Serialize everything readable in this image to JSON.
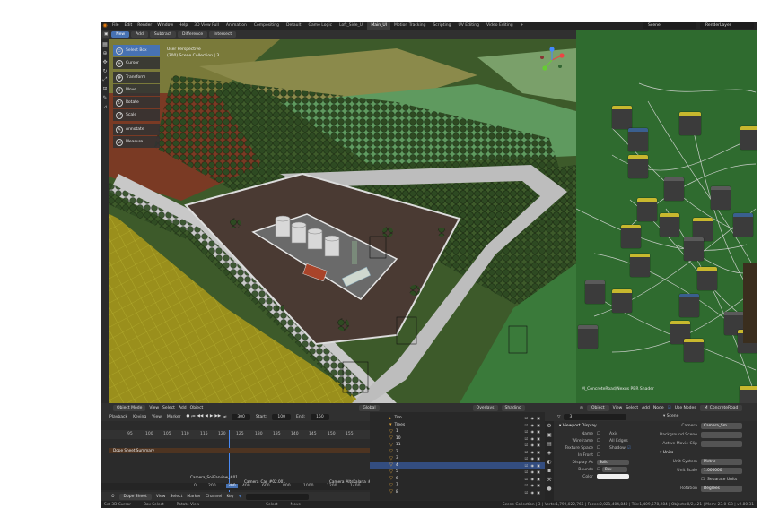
{
  "topbar": {
    "menus": [
      "File",
      "Edit",
      "Render",
      "Window",
      "Help"
    ],
    "workspaces": [
      "3D View Full",
      "Animation",
      "Compositing",
      "Default",
      "Game Logic",
      "Loft_Side_UI",
      "Main_UI",
      "Motion Tracking",
      "Scripting",
      "UV Editing",
      "Video Editing"
    ],
    "active_workspace": "Main_UI",
    "scene": "Scene",
    "render_layer": "RenderLayer"
  },
  "mode_buttons": [
    "New",
    "Add",
    "Subtract",
    "Difference",
    "Intersect"
  ],
  "tools": [
    {
      "label": "Select Box",
      "icon": "select-box-icon",
      "active": true
    },
    {
      "label": "Cursor",
      "icon": "cursor-icon",
      "active": false
    },
    {
      "label": "Transform",
      "icon": "transform-icon",
      "active": false
    },
    {
      "label": "Move",
      "icon": "move-icon",
      "active": false
    },
    {
      "label": "Rotate",
      "icon": "rotate-icon",
      "active": false
    },
    {
      "label": "Scale",
      "icon": "scale-icon",
      "active": false
    },
    {
      "label": "Annotate",
      "icon": "annotate-icon",
      "active": false
    },
    {
      "label": "Measure",
      "icon": "measure-icon",
      "active": false
    }
  ],
  "viewport": {
    "view_name": "User Perspective",
    "collection": "(300) Scene Collection | 3",
    "mode": "Object Mode",
    "menus": [
      "View",
      "Select",
      "Add",
      "Object"
    ],
    "orientation": "Global",
    "overlays": "Overlays",
    "shading": "Shading"
  },
  "node_editor": {
    "material_label": "M_ConcreteRoad/Nexus PBR Shader",
    "object_menu": "Object",
    "menus": [
      "View",
      "Select",
      "Add",
      "Node"
    ],
    "use_nodes": "Use Nodes",
    "material": "M_ConcreteRoad"
  },
  "dope_sheet": {
    "playback": "Playback",
    "keying": "Keying",
    "menus": [
      "View",
      "Marker"
    ],
    "current_frame": "300",
    "start_label": "Start:",
    "start": "100",
    "end_label": "End:",
    "end": "150",
    "ruler_ticks": [
      "95",
      "100",
      "105",
      "110",
      "115",
      "120",
      "125",
      "130",
      "135",
      "140",
      "145",
      "150",
      "155"
    ],
    "summary": "Dope Sheet Summary",
    "markers": [
      "Camera_SoilFarview_#01",
      "Camera_Car_#02.001",
      "Camera_AltsKalaria_#"
    ],
    "bottom_ticks": [
      "0",
      "200",
      "300",
      "400",
      "600",
      "800",
      "1000",
      "1200",
      "1400"
    ],
    "footer_mode": "Dope Sheet",
    "footer_menus": [
      "View",
      "Select",
      "Marker",
      "Channel",
      "Key"
    ]
  },
  "outliner": {
    "rows": [
      {
        "label": "Trm",
        "selected": false
      },
      {
        "label": "Trees",
        "selected": false
      },
      {
        "label": "1",
        "selected": false
      },
      {
        "label": "10",
        "selected": false
      },
      {
        "label": "11",
        "selected": false
      },
      {
        "label": "2",
        "selected": false
      },
      {
        "label": "3",
        "selected": false
      },
      {
        "label": "4",
        "selected": false
      },
      {
        "label": "5",
        "selected": false
      },
      {
        "label": "6",
        "selected": false
      },
      {
        "label": "7",
        "selected": false
      },
      {
        "label": "8",
        "selected": false
      }
    ]
  },
  "properties": {
    "object_name": "3",
    "section": "Viewport Display",
    "fields": [
      {
        "label": "Name",
        "value": "",
        "right_label": "Axis"
      },
      {
        "label": "Wireframe",
        "value": "",
        "right_label": "All Edges"
      },
      {
        "label": "Texture Space",
        "value": "",
        "right_label": "Shadow"
      },
      {
        "label": "In Front",
        "value": ""
      },
      {
        "label": "Display As",
        "value": "Solid"
      },
      {
        "label": "Bounds",
        "value": "Box"
      },
      {
        "label": "Color",
        "value": ""
      }
    ]
  },
  "scene_props": {
    "header": "Scene",
    "camera_label": "Camera",
    "camera": "Camera_Sm",
    "background_label": "Background Scene",
    "movie_clip_label": "Active Movie Clip",
    "units_section": "Units",
    "unit_system_label": "Unit System",
    "unit_system": "Metric",
    "unit_scale_label": "Unit Scale",
    "unit_scale": "1.000000",
    "separate_units": "Separate Units",
    "rotation_label": "Rotation",
    "rotation": "Degrees"
  },
  "status": {
    "left": [
      "Set 3D Cursor",
      "Box Select",
      "Rotate View",
      "Select",
      "Move"
    ],
    "stats": "Scene Collection | 3 | Verts:1,799,022,766 | Faces:2,021,404,840 | Tris:1,409,578,284 | Objects:0/2,421 | Mem: 23.0 GB | v2.80.31"
  },
  "colors": {
    "accent": "#4772b3",
    "node_bg": "#2f6b2f",
    "header": "#303030"
  }
}
